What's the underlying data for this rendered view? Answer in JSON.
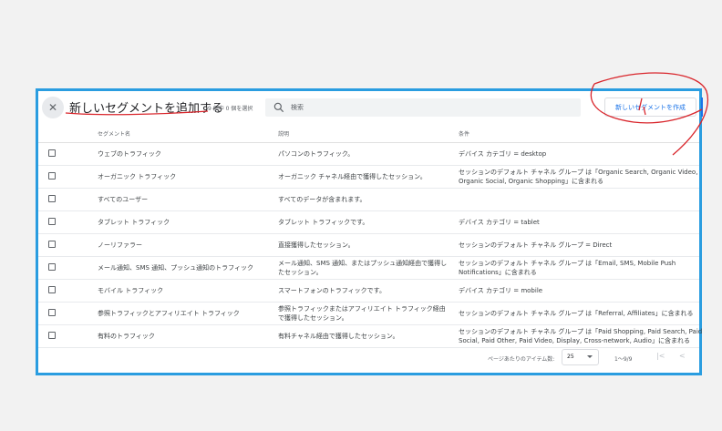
{
  "header": {
    "title": "新しいセグメントを追加する",
    "selection_count": "9 個中 0 個を選択",
    "search_placeholder": "検索",
    "create_button": "新しいセグメントを作成"
  },
  "table": {
    "columns": [
      "セグメント名",
      "説明",
      "条件"
    ],
    "rows": [
      {
        "name": "ウェブのトラフィック",
        "description": "パソコンのトラフィック。",
        "condition": "デバイス カテゴリ = desktop"
      },
      {
        "name": "オーガニック トラフィック",
        "description": "オーガニック チャネル経由で獲得したセッション。",
        "condition": "セッションのデフォルト チャネル グループ は「Organic Search, Organic Video, Organic Social, Organic Shopping」に含まれる"
      },
      {
        "name": "すべてのユーザー",
        "description": "すべてのデータが含まれます。",
        "condition": ""
      },
      {
        "name": "タブレット トラフィック",
        "description": "タブレット トラフィックです。",
        "condition": "デバイス カテゴリ = tablet"
      },
      {
        "name": "ノーリファラー",
        "description": "直接獲得したセッション。",
        "condition": "セッションのデフォルト チャネル グループ = Direct"
      },
      {
        "name": "メール通知、SMS 通知、プッシュ通知のトラフィック",
        "description": "メール通知、SMS 通知、またはプッシュ通知経由で獲得したセッション。",
        "condition": "セッションのデフォルト チャネル グループ は「Email, SMS, Mobile Push Notifications」に含まれる"
      },
      {
        "name": "モバイル トラフィック",
        "description": "スマートフォンのトラフィックです。",
        "condition": "デバイス カテゴリ = mobile"
      },
      {
        "name": "参照トラフィックとアフィリエイト トラフィック",
        "description": "参照トラフィックまたはアフィリエイト トラフィック経由で獲得したセッション。",
        "condition": "セッションのデフォルト チャネル グループ は「Referral, Affiliates」に含まれる"
      },
      {
        "name": "有料のトラフィック",
        "description": "有料チャネル経由で獲得したセッション。",
        "condition": "セッションのデフォルト チャネル グループ は「Paid Shopping, Paid Search, Paid Social, Paid Other, Paid Video, Display, Cross-network, Audio」に含まれる"
      }
    ]
  },
  "footer": {
    "rows_per_page_label": "ページあたりのアイテム数:",
    "rows_per_page_value": "25",
    "range": "1〜9/9"
  },
  "colors": {
    "frame": "#2a9de0",
    "accent": "#1a73e8",
    "annotation": "#d9262c"
  },
  "icons": [
    "close-icon",
    "search-icon",
    "dropdown-caret-icon",
    "first-page-icon",
    "prev-page-icon"
  ]
}
